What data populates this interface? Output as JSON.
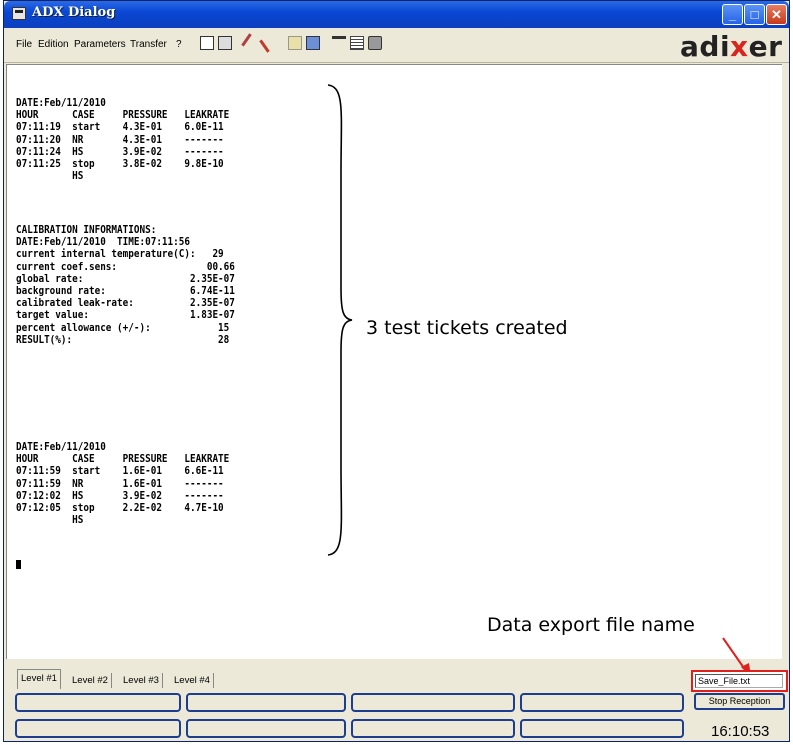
{
  "window": {
    "title": "ADX Dialog"
  },
  "menu": {
    "items": [
      "File",
      "Edition",
      "Parameters",
      "Transfer",
      "?"
    ]
  },
  "brand": {
    "logo_prefix": "adi",
    "logo_x": "x",
    "logo_suffix": "er",
    "accent_color": "#d7261e"
  },
  "console": {
    "ticket1": "DATE:Feb/11/2010\nHOUR      CASE     PRESSURE   LEAKRATE\n07:11:19  start    4.3E-01    6.0E-11\n07:11:20  NR       4.3E-01    -------\n07:11:24  HS       3.9E-02    -------\n07:11:25  stop     3.8E-02    9.8E-10\n          HS",
    "calibration": "CALIBRATION INFORMATIONS:\nDATE:Feb/11/2010  TIME:07:11:56\ncurrent internal temperature(C):   29\ncurrent coef.sens:                00.66\nglobal rate:                   2.35E-07\nbackground rate:               6.74E-11\ncalibrated leak-rate:          2.35E-07\ntarget value:                  1.83E-07\npercent allowance (+/-):            15\nRESULT(%):                          28",
    "ticket2": "DATE:Feb/11/2010\nHOUR      CASE     PRESSURE   LEAKRATE\n07:11:59  start    1.6E-01    6.6E-11\n07:11:59  NR       1.6E-01    -------\n07:12:02  HS       3.9E-02    -------\n07:12:05  stop     2.2E-02    4.7E-10\n          HS"
  },
  "annotations": {
    "tickets": "3 test tickets created",
    "export": "Data export file name",
    "highlight_color": "#e0201d"
  },
  "tabs": [
    "Level #1",
    "Level #2",
    "Level #3",
    "Level #4"
  ],
  "save_file": {
    "value": "Save_File.txt"
  },
  "stop_button": {
    "label": "Stop Reception"
  },
  "status": {
    "time": "16:10:53"
  },
  "icons": [
    "new-file-icon",
    "print-preview-icon",
    "tool-icon",
    "tool-icon",
    "disk-icon",
    "export-icon",
    "settings-icon",
    "list-icon",
    "printer-icon"
  ]
}
